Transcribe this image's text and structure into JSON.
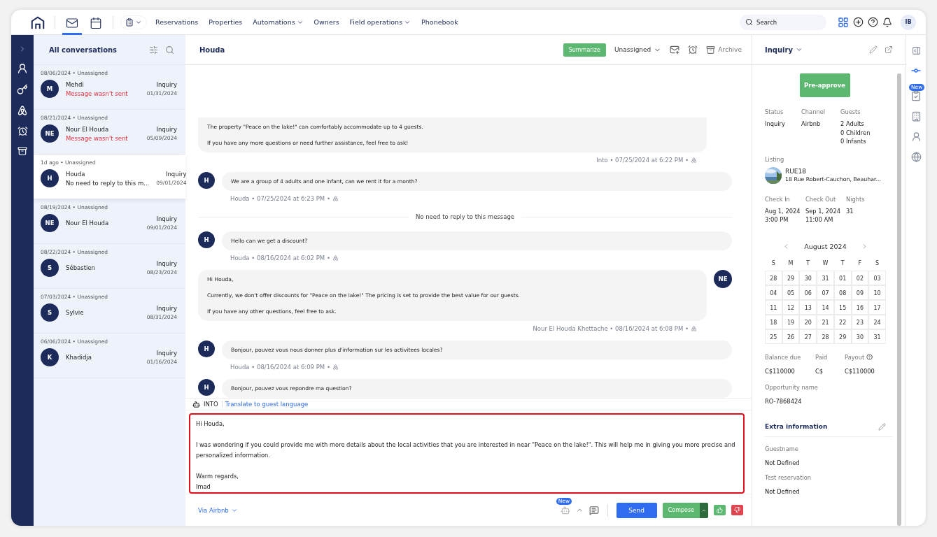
{
  "top_nav": {
    "icon_tabs": [
      {
        "kind": "home",
        "selected": false
      },
      {
        "kind": "mail",
        "selected": true
      },
      {
        "kind": "calendar",
        "selected": false
      }
    ],
    "links": [
      {
        "label": "Reservations",
        "has_menu": false
      },
      {
        "label": "Properties",
        "has_menu": false
      },
      {
        "label": "Automations",
        "has_menu": true
      },
      {
        "label": "Owners",
        "has_menu": false
      },
      {
        "label": "Field operations",
        "has_menu": true
      },
      {
        "label": "Phonebook",
        "has_menu": false
      }
    ],
    "search": {
      "placeholder": "Search"
    },
    "avatar": "IB"
  },
  "conversations": {
    "title": "All conversations",
    "items": [
      {
        "meta": "08/06/2024 • Unassigned",
        "initials": "M",
        "name": "Mehdi",
        "preview": "Message wasn't sent",
        "failed": true,
        "status": "Inquiry",
        "date": "01/31/2024",
        "selected": false
      },
      {
        "meta": "08/21/2024 • Unassigned",
        "initials": "NE",
        "name": "Nour El Houda",
        "preview": "Message wasn't sent",
        "failed": true,
        "status": "Inquiry",
        "date": "05/09/2024",
        "selected": false
      },
      {
        "meta": "1d ago • Unassigned",
        "initials": "H",
        "name": "Houda",
        "preview": "No need to reply to this m...",
        "failed": false,
        "status": "Inquiry",
        "date": "09/01/2024",
        "selected": true
      },
      {
        "meta": "08/19/2024 • Unassigned",
        "initials": "NE",
        "name": "Nour El Houda",
        "status": "Inquiry",
        "date": "09/01/2024",
        "selected": false
      },
      {
        "meta": "08/22/2024 • Unassigned",
        "initials": "S",
        "name": "Sébastien",
        "status": "Inquiry",
        "date": "08/23/2024",
        "selected": false
      },
      {
        "meta": "07/03/2024 • Unassigned",
        "initials": "S",
        "name": "Sylvie",
        "status": "Inquiry",
        "date": "08/31/2024",
        "selected": false
      },
      {
        "meta": "06/06/2024 • Unassigned",
        "initials": "K",
        "name": "Khadidja",
        "status": "Inquiry",
        "date": "01/16/2024",
        "selected": false
      }
    ]
  },
  "chat": {
    "title": "Houda",
    "summarize": "Summarize",
    "assignee": "Unassigned",
    "archive": "Archive",
    "messages": [
      {
        "kind": "host",
        "paragraphs": [
          "The property \"Peace on the lake!\" can comfortably accommodate up to 4 guests.",
          "If you have any more questions or need further assistance, feel free to ask!"
        ],
        "meta": "Into • 07/25/2024 at 6:22 PM •"
      },
      {
        "kind": "guest",
        "initials": "H",
        "paragraphs": [
          "We are a group of 4 adults and one infant, can we rent it for a month?"
        ],
        "meta": "Houda • 07/25/2024 at 6:23 PM •"
      },
      {
        "kind": "note",
        "text": "No need to reply to this message"
      },
      {
        "kind": "guest",
        "initials": "H",
        "paragraphs": [
          "Hello can we get a discount?"
        ],
        "meta": "Houda • 08/16/2024 at 6:02 PM •"
      },
      {
        "kind": "host",
        "initials": "NE",
        "paragraphs": [
          "Hi Houda,",
          "Currently, we don't offer discounts for \"Peace on the lake!\" The pricing is set to provide the best value for our guests.",
          "If you have any other questions, feel free to ask."
        ],
        "meta": "Nour El Houda Khettache • 08/16/2024 at 6:08 PM •"
      },
      {
        "kind": "guest",
        "initials": "H",
        "paragraphs": [
          "Bonjour, pouvez vous nous donner plus d'information sur les activitees locales?"
        ],
        "meta": "Houda • 08/16/2024 at 6:09 PM •"
      },
      {
        "kind": "guest",
        "initials": "H",
        "paragraphs": [
          "Bonjour, pouvez vous repondre ma question?"
        ]
      }
    ],
    "ai_label": "INTO",
    "translate": "Translate to guest language",
    "reply": "Hi Houda,\n\nI was wondering if you could provide me with more details about the local activities that you are interested in near \"Peace on the lake!\". This will help me in giving you more precise and personalized information.\n\nWarm regards,\nImad",
    "channel": "Via Airbnb",
    "new_badge": "New",
    "send": "Send",
    "compose": "Compose"
  },
  "details": {
    "title": "Inquiry",
    "preapprove": "Pre-approve",
    "summary": [
      {
        "label": "Status",
        "lines": [
          "Inquiry"
        ]
      },
      {
        "label": "Channel",
        "lines": [
          "Airbnb"
        ]
      },
      {
        "label": "Guests",
        "lines": [
          "2 Adults",
          "0 Children",
          "0 Infants"
        ]
      }
    ],
    "listing_label": "Listing",
    "listing": {
      "name": "RUE18",
      "address": "18 Rue Robert-Cauchon, Beauhar..."
    },
    "stay": [
      {
        "label": "Check In",
        "lines": [
          "Aug 1, 2024",
          "3:00 PM"
        ]
      },
      {
        "label": "Check Out",
        "lines": [
          "Sep 1, 2024",
          "11:00 AM"
        ]
      },
      {
        "label": "Nights",
        "lines": [
          "31"
        ]
      }
    ],
    "calendar": {
      "month": "August 2024",
      "weekdays": [
        "S",
        "M",
        "T",
        "W",
        "T",
        "F",
        "S"
      ],
      "weeks": [
        [
          "28",
          "29",
          "30",
          "31",
          "01",
          "02",
          "03"
        ],
        [
          "04",
          "05",
          "06",
          "07",
          "08",
          "09",
          "10"
        ],
        [
          "11",
          "12",
          "13",
          "14",
          "15",
          "16",
          "17"
        ],
        [
          "18",
          "19",
          "20",
          "21",
          "22",
          "23",
          "24"
        ],
        [
          "25",
          "26",
          "27",
          "28",
          "29",
          "30",
          "31"
        ]
      ]
    },
    "money": [
      {
        "label": "Balance due",
        "value": "C$110000",
        "help": false
      },
      {
        "label": "Paid",
        "value": "C$",
        "help": false
      },
      {
        "label": "Payout",
        "value": "C$110000",
        "help": true
      }
    ],
    "opportunity": {
      "label": "Opportunity name",
      "value": "RO-7868424"
    },
    "extra": {
      "title": "Extra information",
      "fields": [
        {
          "label": "Guestname",
          "value": "Not Defined"
        },
        {
          "label": "Test reservation",
          "value": "Not Defined"
        }
      ]
    }
  },
  "right_rail": {
    "new_badge": "New"
  }
}
